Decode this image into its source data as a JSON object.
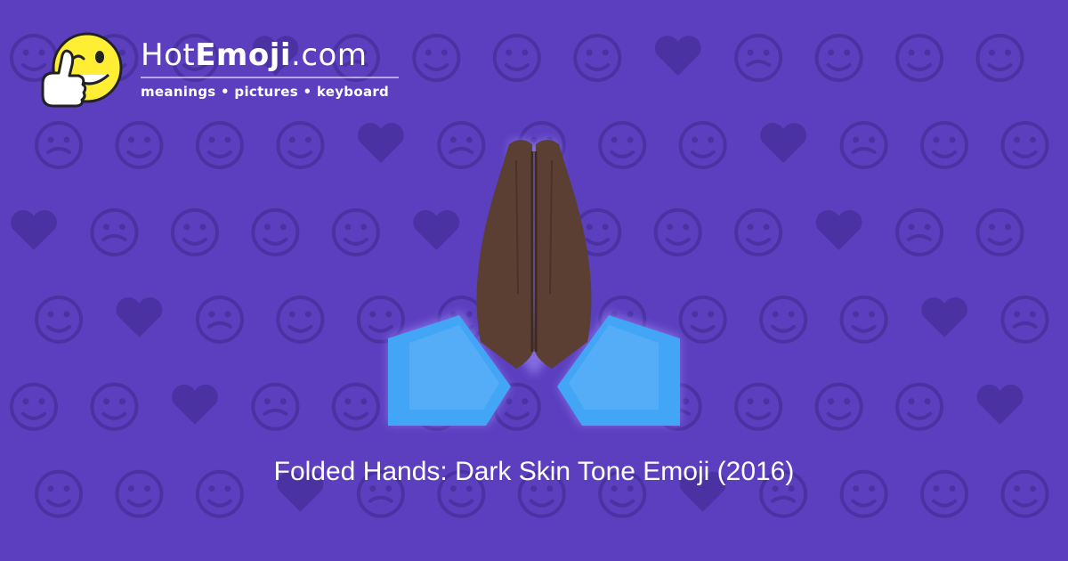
{
  "logo": {
    "name_prefix": "Hot",
    "name_bold": "Emoji",
    "name_suffix": ".com",
    "tagline": "meanings • pictures • keyboard",
    "icon": "winking-thumbs-up-smiley-icon"
  },
  "emoji": {
    "icon": "folded-hands-dark-skin-tone-icon",
    "caption": "Folded Hands: Dark Skin Tone Emoji (2016)"
  },
  "colors": {
    "background": "#5b3fbf",
    "pattern": "#4a32a3",
    "skin": "#5c3f33",
    "skin_shadow": "#3e2a22",
    "sleeve": "#42a5f5",
    "sleeve_light": "#64b5f6",
    "glow": "#8a74e6",
    "logo_face": "#ffee33"
  }
}
